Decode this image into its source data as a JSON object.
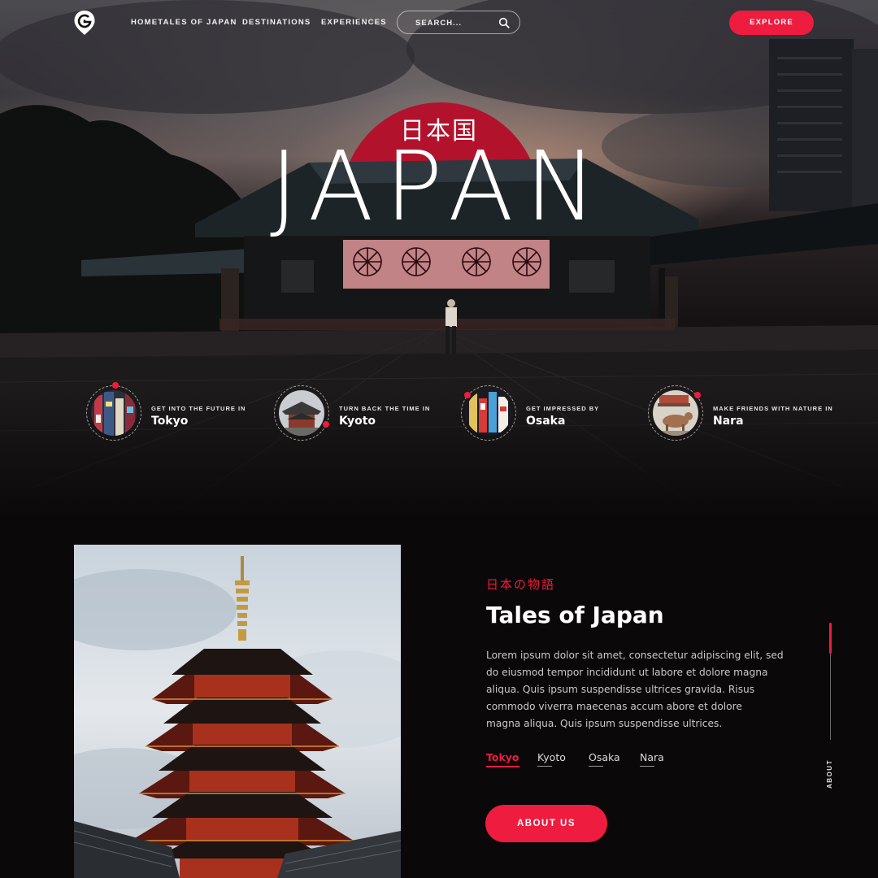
{
  "nav": {
    "links": [
      "HOMETALES OF JAPAN",
      "DESTINATIONS",
      "EXPERIENCES"
    ],
    "search_placeholder": "SEARCH...",
    "explore_label": "EXPLORE"
  },
  "hero": {
    "kanji": "日本国",
    "title": "JAPAN"
  },
  "cities": [
    {
      "kicker": "GET INTO THE FUTURE IN",
      "name": "Tokyo"
    },
    {
      "kicker": "TURN BACK THE TIME IN",
      "name": "Kyoto"
    },
    {
      "kicker": "GET IMPRESSED BY",
      "name": "Osaka"
    },
    {
      "kicker": "MAKE FRIENDS WITH NATURE IN",
      "name": "Nara"
    }
  ],
  "tales": {
    "jp_subtitle": "日本の物語",
    "title": "Tales of Japan",
    "body_lines": [
      "Lorem ipsum dolor sit amet, consectetur adipiscing elit, sed",
      "do eiusmod tempor incididunt ut labore et dolore magna",
      "aliqua. Quis ipsum suspendisse ultrices gravida. Risus",
      "commodo viverra maecenas accum abore et dolore",
      "magna aliqua. Quis ipsum suspendisse ultrices."
    ],
    "tabs": [
      "Tokyo",
      "Kyoto",
      "Osaka",
      "Nara"
    ],
    "active_tab": "Tokyo",
    "cta_label": "ABOUT US",
    "side_label": "ABOUT"
  },
  "colors": {
    "accent": "#ee1c3f",
    "background": "#0b0809"
  },
  "icons": {
    "logo": "location-pin-g-logo",
    "search": "search-icon"
  }
}
